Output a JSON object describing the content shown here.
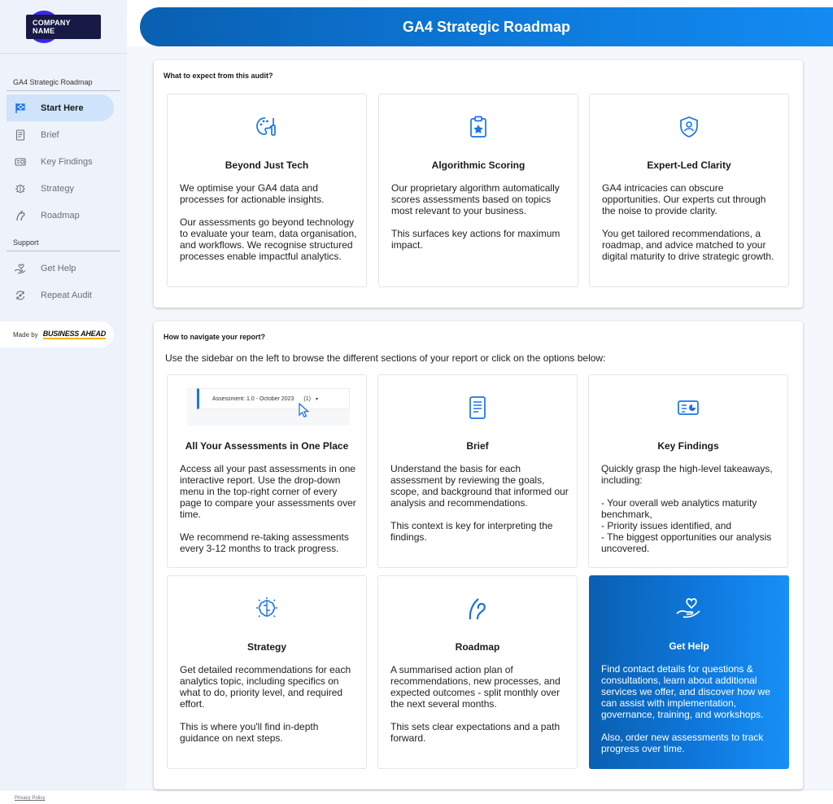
{
  "brand": {
    "logo_text": "COMPANY NAME"
  },
  "header": {
    "title": "GA4 Strategic Roadmap"
  },
  "sidebar": {
    "section_main": "GA4 Strategic Roadmap",
    "items": [
      {
        "label": "Start Here",
        "icon": "checkered-flag-icon",
        "active": true
      },
      {
        "label": "Brief",
        "icon": "document-icon"
      },
      {
        "label": "Key Findings",
        "icon": "chart-card-icon"
      },
      {
        "label": "Strategy",
        "icon": "brain-icon"
      },
      {
        "label": "Roadmap",
        "icon": "road-icon"
      }
    ],
    "section_support": "Support",
    "support_items": [
      {
        "label": "Get Help",
        "icon": "helping-hand-icon"
      },
      {
        "label": "Repeat Audit",
        "icon": "repeat-icon"
      }
    ],
    "made_by_label": "Made by",
    "made_by_brand": "BUSINESS AHEAD",
    "privacy": "Privacy Policy"
  },
  "panel1": {
    "title": "What to expect from this audit?",
    "cards": [
      {
        "title": "Beyond Just Tech",
        "icon": "palette-brush-icon",
        "p1": "We optimise your GA4 data and processes for actionable insights.",
        "p2": "Our assessments go beyond technology to evaluate your team, data organisation, and workflows. We recognise structured processes enable impactful analytics."
      },
      {
        "title": "Algorithmic Scoring",
        "icon": "clipboard-star-icon",
        "p1": "Our proprietary algorithm automatically scores assessments based on topics most relevant to your business.",
        "p2": "This surfaces key actions for maximum impact."
      },
      {
        "title": "Expert-Led Clarity",
        "icon": "shield-user-icon",
        "p1": "GA4 intricacies can obscure opportunities. Our experts cut through the noise to provide clarity.",
        "p2": "You get tailored recommendations, a roadmap, and advice matched to your digital maturity to drive strategic growth."
      }
    ]
  },
  "panel2": {
    "title": "How to navigate your report?",
    "intro": "Use the sidebar on the left to browse the different sections of your report or click on the options below:",
    "assessment_preview": {
      "label": "Assessment: 1.0 - October 2023",
      "count": "(1)"
    },
    "cards": [
      {
        "title": "All Your Assessments in One Place",
        "p1": "Access all your past assessments in one interactive report. Use the drop-down menu in the top-right corner of every page to compare your assessments over time.",
        "p2": "We recommend re-taking assessments every 3-12 months to track progress."
      },
      {
        "title": "Brief",
        "icon": "document-icon",
        "p1": "Understand the basis for each assessment by reviewing the goals, scope, and background that informed our analysis and recommendations.",
        "p2": "This context is key for interpreting the findings."
      },
      {
        "title": "Key Findings",
        "icon": "chart-card-icon",
        "p1": "Quickly grasp the high-level takeaways, including:",
        "p2": "- Your overall web analytics maturity benchmark,\n- Priority issues identified, and\n- The biggest opportunities our analysis uncovered."
      },
      {
        "title": "Strategy",
        "icon": "brain-icon",
        "p1": "Get detailed recommendations for each analytics topic, including specifics on what to do, priority level, and required effort.",
        "p2": "This is where you'll find in-depth guidance on next steps."
      },
      {
        "title": "Roadmap",
        "icon": "road-icon",
        "p1": "A summarised action plan of recommendations, new processes, and expected outcomes - split monthly over the next several months.",
        "p2": "This sets clear expectations and a path forward."
      },
      {
        "title": "Get Help",
        "icon": "helping-hand-icon",
        "p1": "Find contact details for questions & consultations, learn about additional services we offer, and discover how we can assist with implementation, governance, training, and workshops.",
        "p2": "Also, order new assessments to track progress over time."
      }
    ]
  },
  "colors": {
    "accent": "#1a73e8",
    "header_gradient_start": "#0a5fb0",
    "header_gradient_end": "#138bf2",
    "active_nav": "#cfe3fb",
    "logo_circle": "#3b27f0",
    "logo_pill": "#171a45"
  }
}
